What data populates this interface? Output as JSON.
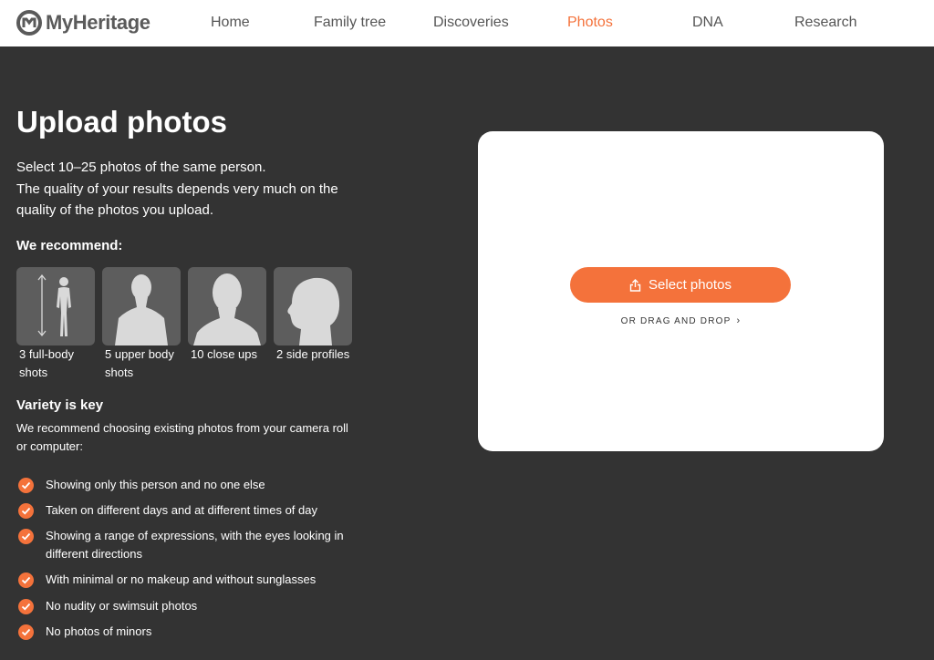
{
  "header": {
    "brand": "MyHeritage",
    "nav": [
      {
        "label": "Home"
      },
      {
        "label": "Family tree"
      },
      {
        "label": "Discoveries"
      },
      {
        "label": "Photos"
      },
      {
        "label": "DNA"
      },
      {
        "label": "Research"
      }
    ],
    "active_nav": "Photos"
  },
  "main": {
    "title": "Upload photos",
    "intro_line1": "Select 10–25 photos of the same person.",
    "intro_line2": "The quality of your results depends very much on the",
    "intro_line3": "quality of the photos you upload.",
    "recommend_heading": "We recommend:",
    "shots": [
      {
        "label_1": "3 full-body",
        "label_2": "shots",
        "icon": "full-body-icon"
      },
      {
        "label_1": "5 upper body",
        "label_2": "shots",
        "icon": "upper-body-icon"
      },
      {
        "label_1": "10 close ups",
        "label_2": "",
        "icon": "close-up-icon"
      },
      {
        "label_1": "2 side profiles",
        "label_2": "",
        "icon": "side-profile-icon"
      }
    ],
    "variety_heading": "Variety is key",
    "variety_line1": "We recommend choosing existing photos from your camera roll",
    "variety_line2": "or computer:",
    "checklist": [
      {
        "line1": "Showing only this person and no one else",
        "line2": ""
      },
      {
        "line1": "Taken on different days and at different times of day",
        "line2": ""
      },
      {
        "line1": "Showing a range of expressions, with the eyes looking in",
        "line2": "different directions"
      },
      {
        "line1": "With minimal or no makeup and without sunglasses",
        "line2": ""
      },
      {
        "line1": "No nudity or swimsuit photos",
        "line2": ""
      },
      {
        "line1": "No photos of minors",
        "line2": ""
      }
    ]
  },
  "upload": {
    "button_label": "Select photos",
    "drag_drop_label": "OR DRAG AND DROP"
  },
  "colors": {
    "accent": "#f4723b",
    "background": "#333333",
    "card": "#ffffff",
    "tile": "#5d5d5d"
  }
}
